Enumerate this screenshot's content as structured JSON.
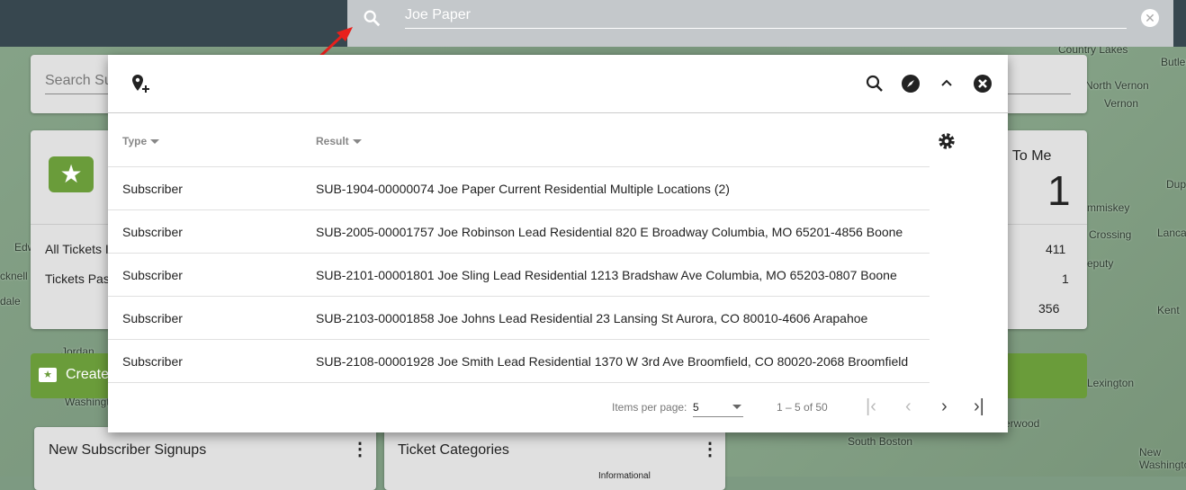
{
  "search": {
    "value": "Joe Paper"
  },
  "background": {
    "search_placeholder": "Search Su",
    "ticket_stats": {
      "assigned_label": "ned To Me",
      "assigned_count": "1",
      "rows": [
        {
          "label": "All Tickets I",
          "value": "411"
        },
        {
          "label": "Tickets Pas",
          "value": "1"
        },
        {
          "label": "",
          "value": "356"
        }
      ]
    },
    "create_label": "Create",
    "cards": [
      {
        "title": "New Subscriber Signups"
      },
      {
        "title": "Ticket Categories",
        "legend": "Informational"
      }
    ],
    "map_labels": [
      "Country Lakes",
      "Butler",
      "North Vernon",
      "Vernon",
      "Dup",
      "Lanca",
      "Crossing",
      "mmiskey",
      "eputy",
      "Kent",
      "Lexington",
      "erwood",
      "New Washingto",
      "South Boston",
      "Jordan",
      "Washingt",
      "Edw",
      "cknell",
      "dale"
    ]
  },
  "dialog": {
    "columns": [
      {
        "label": "Type"
      },
      {
        "label": "Result"
      }
    ],
    "rows": [
      {
        "type": "Subscriber",
        "result": "SUB-1904-00000074 Joe Paper Current Residential Multiple Locations (2)"
      },
      {
        "type": "Subscriber",
        "result": "SUB-2005-00001757 Joe Robinson Lead Residential 820 E Broadway Columbia, MO 65201-4856 Boone"
      },
      {
        "type": "Subscriber",
        "result": "SUB-2101-00001801 Joe Sling Lead Residential 1213 Bradshaw Ave Columbia, MO 65203-0807 Boone"
      },
      {
        "type": "Subscriber",
        "result": "SUB-2103-00001858 Joe Johns Lead Residential 23 Lansing St Aurora, CO 80010-4606 Arapahoe"
      },
      {
        "type": "Subscriber",
        "result": "SUB-2108-00001928 Joe Smith Lead Residential 1370 W 3rd Ave Broomfield, CO 80020-2068 Broomfield"
      }
    ],
    "paginator": {
      "items_per_page_label": "Items per page:",
      "items_per_page": "5",
      "range": "1 – 5 of 50"
    }
  },
  "colors": {
    "topbar": "#37474f",
    "accent_green": "#6a9c3a",
    "arrow": "#e8201c"
  }
}
